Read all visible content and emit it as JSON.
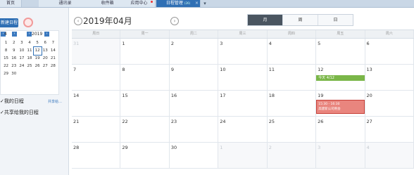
{
  "tabs": [
    {
      "label": "首页"
    },
    {
      "label": "通讯录"
    },
    {
      "label": "收件箱"
    },
    {
      "label": "应用中心"
    },
    {
      "label": "日程管理",
      "badge": "(26)"
    }
  ],
  "sidebar": {
    "new_button": "新建日程",
    "mini_calendar": {
      "month": "4",
      "year": "2019",
      "weeks": [
        [
          "1",
          "2",
          "3",
          "4",
          "5",
          "6",
          "7"
        ],
        [
          "8",
          "9",
          "10",
          "11",
          "12",
          "13",
          "14"
        ],
        [
          "15",
          "16",
          "17",
          "18",
          "19",
          "20",
          "21"
        ],
        [
          "22",
          "23",
          "24",
          "25",
          "26",
          "27",
          "28"
        ],
        [
          "29",
          "30",
          "",
          "",
          "",
          "",
          ""
        ]
      ]
    },
    "my_schedule": "我的日程",
    "share_link": "共享给…",
    "shared_schedule": "共享给我的日程"
  },
  "header": {
    "title": "2019年04月",
    "views": [
      "月",
      "周",
      "日"
    ]
  },
  "calendar": {
    "weekdays": [
      "周日",
      "周一",
      "周二",
      "周三",
      "周四",
      "周五",
      "周六"
    ],
    "weeks": [
      [
        {
          "day": "31",
          "lunar": "",
          "other": true
        },
        {
          "day": "1",
          "lunar": "",
          "other": false
        },
        {
          "day": "2",
          "lunar": "",
          "other": false
        },
        {
          "day": "3",
          "lunar": "",
          "other": false
        },
        {
          "day": "4",
          "lunar": "",
          "other": false
        },
        {
          "day": "5",
          "lunar": "",
          "other": false
        },
        {
          "day": "6",
          "lunar": "",
          "other": false
        }
      ],
      [
        {
          "day": "7",
          "lunar": "",
          "other": false
        },
        {
          "day": "8",
          "lunar": "",
          "other": false
        },
        {
          "day": "9",
          "lunar": "",
          "other": false
        },
        {
          "day": "10",
          "lunar": "",
          "other": false
        },
        {
          "day": "11",
          "lunar": "",
          "other": false
        },
        {
          "day": "12",
          "lunar": "",
          "other": false
        },
        {
          "day": "13",
          "lunar": "",
          "other": false
        }
      ],
      [
        {
          "day": "14",
          "lunar": "",
          "other": false
        },
        {
          "day": "15",
          "lunar": "",
          "other": false
        },
        {
          "day": "16",
          "lunar": "",
          "other": false
        },
        {
          "day": "17",
          "lunar": "",
          "other": false
        },
        {
          "day": "18",
          "lunar": "",
          "other": false
        },
        {
          "day": "19",
          "lunar": "",
          "other": false
        },
        {
          "day": "20",
          "lunar": "",
          "other": false
        }
      ],
      [
        {
          "day": "21",
          "lunar": "",
          "other": false
        },
        {
          "day": "22",
          "lunar": "",
          "other": false
        },
        {
          "day": "23",
          "lunar": "",
          "other": false
        },
        {
          "day": "24",
          "lunar": "",
          "other": false
        },
        {
          "day": "25",
          "lunar": "",
          "other": false
        },
        {
          "day": "26",
          "lunar": "",
          "other": false
        },
        {
          "day": "27",
          "lunar": "",
          "other": false
        }
      ],
      [
        {
          "day": "28",
          "lunar": "",
          "other": false
        },
        {
          "day": "29",
          "lunar": "",
          "other": false
        },
        {
          "day": "30",
          "lunar": "",
          "other": false
        },
        {
          "day": "1",
          "lunar": "",
          "other": true
        },
        {
          "day": "2",
          "lunar": "",
          "other": true
        },
        {
          "day": "3",
          "lunar": "",
          "other": true
        },
        {
          "day": "4",
          "lunar": "",
          "other": true
        }
      ]
    ],
    "events": {
      "green": {
        "label": "今天 4/12"
      },
      "red": {
        "time": "15:30 - 16:30",
        "text": "高建新公司例会"
      }
    }
  },
  "colors": {
    "accent": "#2f6fb4",
    "event_green": "#7ab648",
    "event_red": "#e9857e"
  }
}
